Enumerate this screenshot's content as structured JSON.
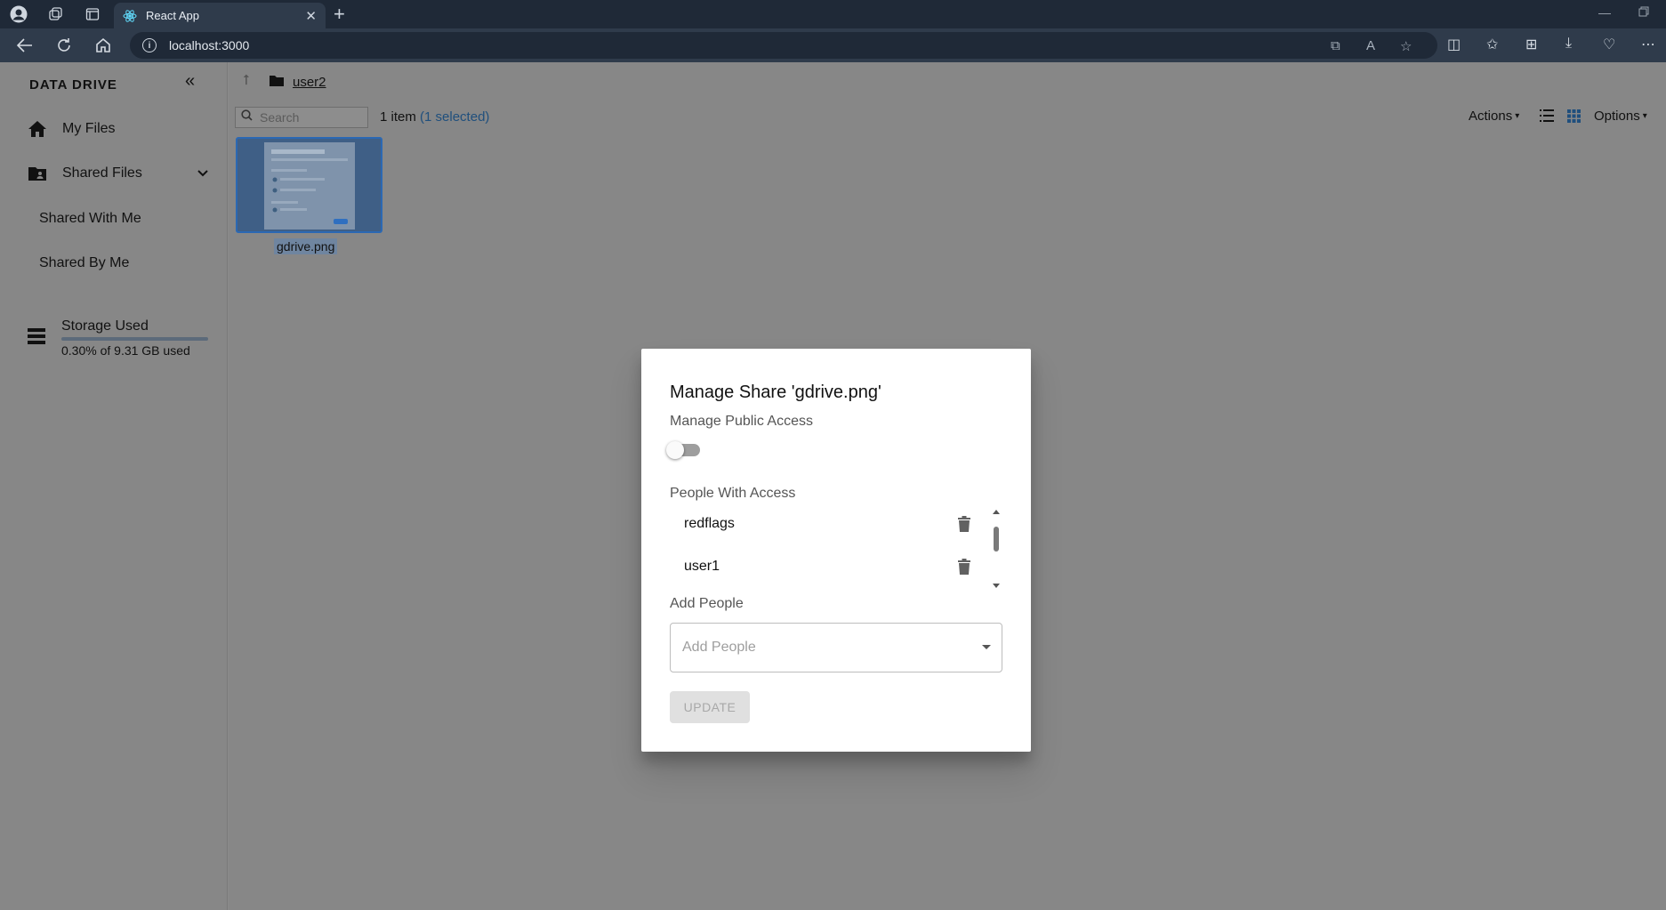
{
  "browser": {
    "tab_title": "React App",
    "url": "localhost:3000"
  },
  "sidebar": {
    "brand": "DATA DRIVE",
    "my_files": "My Files",
    "shared_files": "Shared Files",
    "shared_with_me": "Shared With Me",
    "shared_by_me": "Shared By Me",
    "storage_title": "Storage Used",
    "storage_text": "0.30% of 9.31 GB used",
    "storage_used_percent": 0.3
  },
  "main": {
    "breadcrumb": "user2",
    "search_placeholder": "Search",
    "item_count": "1 item",
    "selected_count": "(1 selected)",
    "actions_label": "Actions",
    "options_label": "Options",
    "file_name": "gdrive.png"
  },
  "dialog": {
    "title": "Manage Share 'gdrive.png'",
    "public_access_label": "Manage Public Access",
    "public_access_enabled": false,
    "people_label": "People With Access",
    "people": [
      "redflags",
      "user1"
    ],
    "add_people_label": "Add People",
    "add_people_placeholder": "Add People",
    "update_label": "UPDATE"
  }
}
